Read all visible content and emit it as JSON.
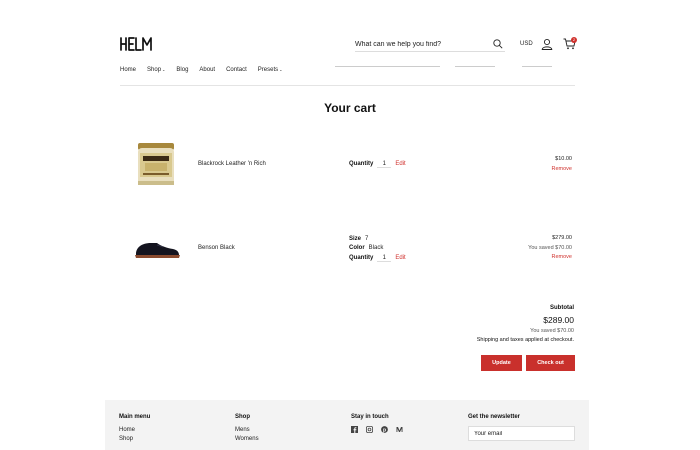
{
  "header": {
    "logo_text": "HELM",
    "search_placeholder": "What can we help you find?",
    "currency": "USD",
    "cart_count": "2"
  },
  "nav": {
    "items": [
      "Home",
      "Shop",
      "Blog",
      "About",
      "Contact",
      "Presets"
    ]
  },
  "page_title": "Your cart",
  "cart": {
    "items": [
      {
        "name": "Blackrock Leather 'n Rich",
        "quantity_label": "Quantity",
        "quantity": "1",
        "edit_label": "Edit",
        "price": "$10.00",
        "remove_label": "Remove"
      },
      {
        "name": "Benson Black",
        "size_label": "Size",
        "size": "7",
        "color_label": "Color",
        "color": "Black",
        "quantity_label": "Quantity",
        "quantity": "1",
        "edit_label": "Edit",
        "price": "$279.00",
        "saved": "You saved $70.00",
        "remove_label": "Remove"
      }
    ]
  },
  "summary": {
    "subtotal_label": "Subtotal",
    "subtotal": "$289.00",
    "saved": "You saved $70.00",
    "shipping_note": "Shipping and taxes applied at checkout.",
    "update_label": "Update",
    "checkout_label": "Check out"
  },
  "footer": {
    "main_menu_title": "Main menu",
    "main_menu": [
      "Home",
      "Shop"
    ],
    "shop_title": "Shop",
    "shop_links": [
      "Mens",
      "Womens"
    ],
    "social_title": "Stay in touch",
    "newsletter_title": "Get the newsletter",
    "email_placeholder": "Your email"
  },
  "colors": {
    "accent": "#c9302c",
    "footer_bg": "#f3f3f3"
  }
}
